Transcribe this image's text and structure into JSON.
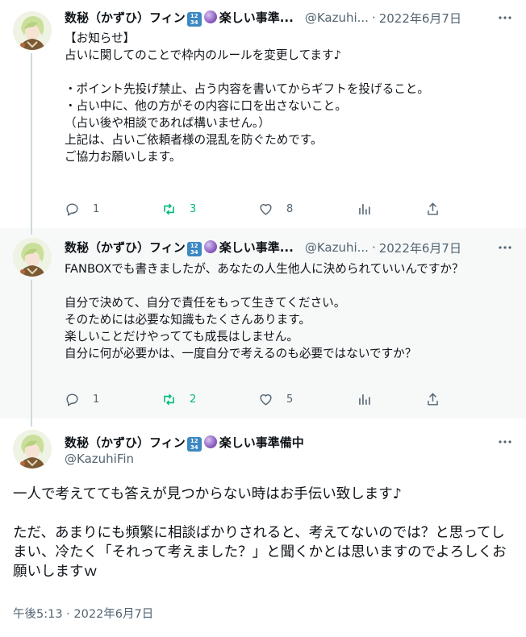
{
  "tweets": [
    {
      "name": "数秘（かずひ）フィン",
      "badge": "1234",
      "name_suffix": "楽しい事準...",
      "handle": "@Kazuhi...",
      "separator": "·",
      "date": "2022年6月7日",
      "body": "【お知らせ】\n占いに関してのことで枠内のルールを変更してます♪\n\n・ポイント先投げ禁止、占う内容を書いてからギフトを投げること。\n・占い中に、他の方がその内容に口を出さないこと。\n（占い後や相談であれば構いません。）\n上記は、占いご依頼者様の混乱を防ぐためです。\nご協力お願いします。",
      "replies": "1",
      "retweets": "3",
      "likes": "8"
    },
    {
      "name": "数秘（かずひ）フィン",
      "badge": "1234",
      "name_suffix": "楽しい事準...",
      "handle": "@Kazuhi...",
      "separator": "·",
      "date": "2022年6月7日",
      "body": "FANBOXでも書きましたが、あなたの人生他人に決められていいんですか？\n\n自分で決めて、自分で責任をもって生きてください。\nそのためには必要な知識もたくさんあります。\n楽しいことだけやってても成長はしません。\n自分に何が必要かは、一度自分で考えるのも必要ではないですか？",
      "replies": "1",
      "retweets": "2",
      "likes": "5"
    }
  ],
  "main_tweet": {
    "name": "数秘（かずひ）フィン",
    "badge": "1234",
    "name_suffix": "楽しい事準備中",
    "handle": "@KazuhiFin",
    "body": "一人で考えてても答えが見つからない時はお手伝い致します♪\n\nただ、あまりにも頻繁に相談ばかりされると、考えてないのでは？と思ってしまい、冷たく「それって考えました？」と聞くかとは思いますのでよろしくお願いしますｗ",
    "timestamp": "午後5:13 · 2022年6月7日"
  },
  "icons": {
    "more": "more-icon",
    "reply": "reply-icon",
    "retweet": "retweet-icon",
    "like": "heart-icon",
    "views": "views-icon",
    "share": "share-icon"
  },
  "colors": {
    "text": "#0f1419",
    "secondary": "#536471",
    "retweet_green": "#00ba7c",
    "thread_line": "#cfd9de",
    "highlight_bg": "#f7f9f9"
  }
}
